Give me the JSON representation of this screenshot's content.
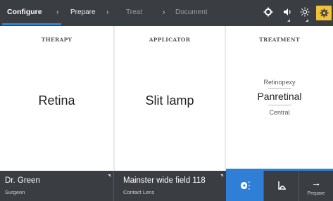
{
  "header": {
    "tabs": [
      {
        "label": "Configure",
        "state": "active"
      },
      {
        "label": "Prepare",
        "state": "normal"
      },
      {
        "label": "Treat",
        "state": "disabled"
      },
      {
        "label": "Document",
        "state": "disabled"
      }
    ],
    "separator": "›",
    "icons": [
      "brightness-icon",
      "volume-icon",
      "sun-icon",
      "settings-icon"
    ]
  },
  "panels": {
    "therapy": {
      "title": "THERAPY",
      "value": "Retina"
    },
    "applicator": {
      "title": "APPLICATOR",
      "value": "Slit lamp"
    },
    "treatment": {
      "title": "TREATMENT",
      "options": [
        "Retinopexy",
        "Panretinal",
        "Central"
      ],
      "selected": "Panretinal"
    }
  },
  "footer": {
    "surgeon": {
      "name": "Dr. Green",
      "role": "Surgeon"
    },
    "lens": {
      "name": "Mainster wide field 118",
      "type": "Contact Lens"
    },
    "next_label": "Prepare"
  },
  "colors": {
    "accent": "#2f7fd6",
    "settings": "#f0c23a",
    "bar": "#3a3d42"
  }
}
